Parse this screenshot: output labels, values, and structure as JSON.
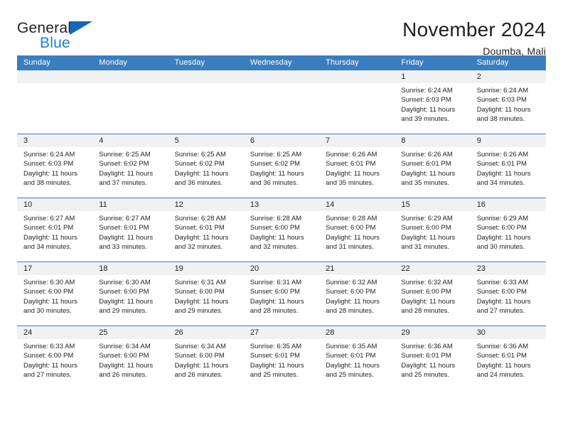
{
  "logo": {
    "word_top": "General",
    "word_bottom": "Blue",
    "triangle_color": "#1668b3",
    "blue_color": "#1a82d4"
  },
  "header": {
    "title": "November 2024",
    "subtitle": "Doumba, Mali"
  },
  "theme": {
    "header_blue": "#3a7ebf",
    "day_strip_gray": "#f1f1f1",
    "text": "#231f20"
  },
  "calendar": {
    "weekdays": [
      "Sunday",
      "Monday",
      "Tuesday",
      "Wednesday",
      "Thursday",
      "Friday",
      "Saturday"
    ],
    "weeks": [
      [
        {
          "day": "",
          "sunrise": "",
          "sunset": "",
          "daylight": ""
        },
        {
          "day": "",
          "sunrise": "",
          "sunset": "",
          "daylight": ""
        },
        {
          "day": "",
          "sunrise": "",
          "sunset": "",
          "daylight": ""
        },
        {
          "day": "",
          "sunrise": "",
          "sunset": "",
          "daylight": ""
        },
        {
          "day": "",
          "sunrise": "",
          "sunset": "",
          "daylight": ""
        },
        {
          "day": "1",
          "sunrise": "Sunrise: 6:24 AM",
          "sunset": "Sunset: 6:03 PM",
          "daylight": "Daylight: 11 hours and 39 minutes."
        },
        {
          "day": "2",
          "sunrise": "Sunrise: 6:24 AM",
          "sunset": "Sunset: 6:03 PM",
          "daylight": "Daylight: 11 hours and 38 minutes."
        }
      ],
      [
        {
          "day": "3",
          "sunrise": "Sunrise: 6:24 AM",
          "sunset": "Sunset: 6:03 PM",
          "daylight": "Daylight: 11 hours and 38 minutes."
        },
        {
          "day": "4",
          "sunrise": "Sunrise: 6:25 AM",
          "sunset": "Sunset: 6:02 PM",
          "daylight": "Daylight: 11 hours and 37 minutes."
        },
        {
          "day": "5",
          "sunrise": "Sunrise: 6:25 AM",
          "sunset": "Sunset: 6:02 PM",
          "daylight": "Daylight: 11 hours and 36 minutes."
        },
        {
          "day": "6",
          "sunrise": "Sunrise: 6:25 AM",
          "sunset": "Sunset: 6:02 PM",
          "daylight": "Daylight: 11 hours and 36 minutes."
        },
        {
          "day": "7",
          "sunrise": "Sunrise: 6:26 AM",
          "sunset": "Sunset: 6:01 PM",
          "daylight": "Daylight: 11 hours and 35 minutes."
        },
        {
          "day": "8",
          "sunrise": "Sunrise: 6:26 AM",
          "sunset": "Sunset: 6:01 PM",
          "daylight": "Daylight: 11 hours and 35 minutes."
        },
        {
          "day": "9",
          "sunrise": "Sunrise: 6:26 AM",
          "sunset": "Sunset: 6:01 PM",
          "daylight": "Daylight: 11 hours and 34 minutes."
        }
      ],
      [
        {
          "day": "10",
          "sunrise": "Sunrise: 6:27 AM",
          "sunset": "Sunset: 6:01 PM",
          "daylight": "Daylight: 11 hours and 34 minutes."
        },
        {
          "day": "11",
          "sunrise": "Sunrise: 6:27 AM",
          "sunset": "Sunset: 6:01 PM",
          "daylight": "Daylight: 11 hours and 33 minutes."
        },
        {
          "day": "12",
          "sunrise": "Sunrise: 6:28 AM",
          "sunset": "Sunset: 6:01 PM",
          "daylight": "Daylight: 11 hours and 32 minutes."
        },
        {
          "day": "13",
          "sunrise": "Sunrise: 6:28 AM",
          "sunset": "Sunset: 6:00 PM",
          "daylight": "Daylight: 11 hours and 32 minutes."
        },
        {
          "day": "14",
          "sunrise": "Sunrise: 6:28 AM",
          "sunset": "Sunset: 6:00 PM",
          "daylight": "Daylight: 11 hours and 31 minutes."
        },
        {
          "day": "15",
          "sunrise": "Sunrise: 6:29 AM",
          "sunset": "Sunset: 6:00 PM",
          "daylight": "Daylight: 11 hours and 31 minutes."
        },
        {
          "day": "16",
          "sunrise": "Sunrise: 6:29 AM",
          "sunset": "Sunset: 6:00 PM",
          "daylight": "Daylight: 11 hours and 30 minutes."
        }
      ],
      [
        {
          "day": "17",
          "sunrise": "Sunrise: 6:30 AM",
          "sunset": "Sunset: 6:00 PM",
          "daylight": "Daylight: 11 hours and 30 minutes."
        },
        {
          "day": "18",
          "sunrise": "Sunrise: 6:30 AM",
          "sunset": "Sunset: 6:00 PM",
          "daylight": "Daylight: 11 hours and 29 minutes."
        },
        {
          "day": "19",
          "sunrise": "Sunrise: 6:31 AM",
          "sunset": "Sunset: 6:00 PM",
          "daylight": "Daylight: 11 hours and 29 minutes."
        },
        {
          "day": "20",
          "sunrise": "Sunrise: 6:31 AM",
          "sunset": "Sunset: 6:00 PM",
          "daylight": "Daylight: 11 hours and 28 minutes."
        },
        {
          "day": "21",
          "sunrise": "Sunrise: 6:32 AM",
          "sunset": "Sunset: 6:00 PM",
          "daylight": "Daylight: 11 hours and 28 minutes."
        },
        {
          "day": "22",
          "sunrise": "Sunrise: 6:32 AM",
          "sunset": "Sunset: 6:00 PM",
          "daylight": "Daylight: 11 hours and 28 minutes."
        },
        {
          "day": "23",
          "sunrise": "Sunrise: 6:33 AM",
          "sunset": "Sunset: 6:00 PM",
          "daylight": "Daylight: 11 hours and 27 minutes."
        }
      ],
      [
        {
          "day": "24",
          "sunrise": "Sunrise: 6:33 AM",
          "sunset": "Sunset: 6:00 PM",
          "daylight": "Daylight: 11 hours and 27 minutes."
        },
        {
          "day": "25",
          "sunrise": "Sunrise: 6:34 AM",
          "sunset": "Sunset: 6:00 PM",
          "daylight": "Daylight: 11 hours and 26 minutes."
        },
        {
          "day": "26",
          "sunrise": "Sunrise: 6:34 AM",
          "sunset": "Sunset: 6:00 PM",
          "daylight": "Daylight: 11 hours and 26 minutes."
        },
        {
          "day": "27",
          "sunrise": "Sunrise: 6:35 AM",
          "sunset": "Sunset: 6:01 PM",
          "daylight": "Daylight: 11 hours and 25 minutes."
        },
        {
          "day": "28",
          "sunrise": "Sunrise: 6:35 AM",
          "sunset": "Sunset: 6:01 PM",
          "daylight": "Daylight: 11 hours and 25 minutes."
        },
        {
          "day": "29",
          "sunrise": "Sunrise: 6:36 AM",
          "sunset": "Sunset: 6:01 PM",
          "daylight": "Daylight: 11 hours and 25 minutes."
        },
        {
          "day": "30",
          "sunrise": "Sunrise: 6:36 AM",
          "sunset": "Sunset: 6:01 PM",
          "daylight": "Daylight: 11 hours and 24 minutes."
        }
      ]
    ]
  }
}
